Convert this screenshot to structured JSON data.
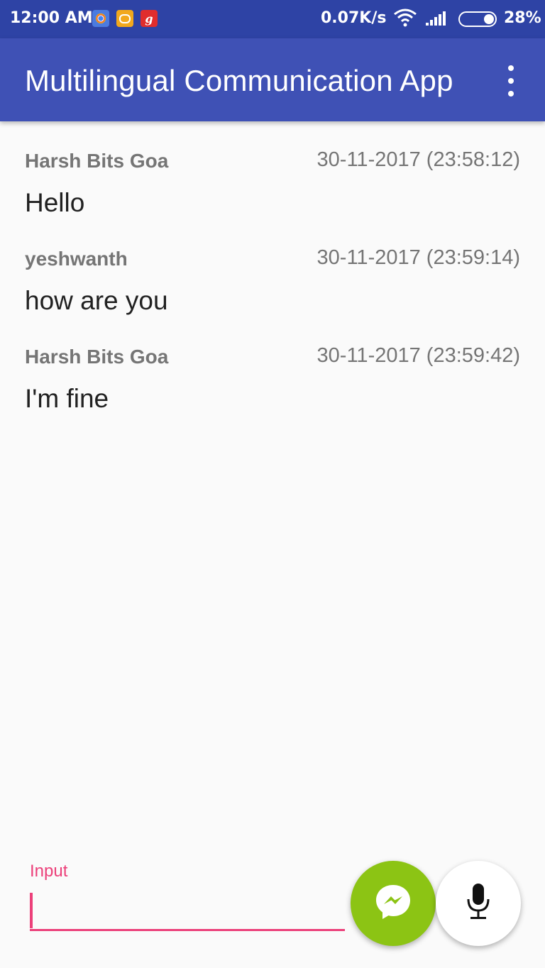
{
  "status_bar": {
    "time": "12:00 AM",
    "notification_icons": [
      "chrome-icon",
      "chat-bubble-icon",
      "gaana-icon"
    ],
    "red_app_glyph": "g",
    "network_speed": "0.07K/s",
    "battery_percent": "28%"
  },
  "app_bar": {
    "title": "Multilingual Communication App",
    "menu_icon": "overflow-menu-icon"
  },
  "messages": [
    {
      "sender": "Harsh Bits Goa",
      "timestamp": "30-11-2017 (23:58:12)",
      "text": "Hello"
    },
    {
      "sender": "yeshwanth",
      "timestamp": "30-11-2017 (23:59:14)",
      "text": "how are you"
    },
    {
      "sender": "Harsh Bits Goa",
      "timestamp": "30-11-2017 (23:59:42)",
      "text": "I'm fine"
    }
  ],
  "composer": {
    "input_label": "Input",
    "input_value": "",
    "send_icon": "messenger-icon",
    "mic_icon": "microphone-icon"
  },
  "colors": {
    "status_bar": "#2e43a5",
    "app_bar": "#3f51b5",
    "accent": "#ec407a",
    "send_button": "#8cc414",
    "background": "#fafafa"
  }
}
